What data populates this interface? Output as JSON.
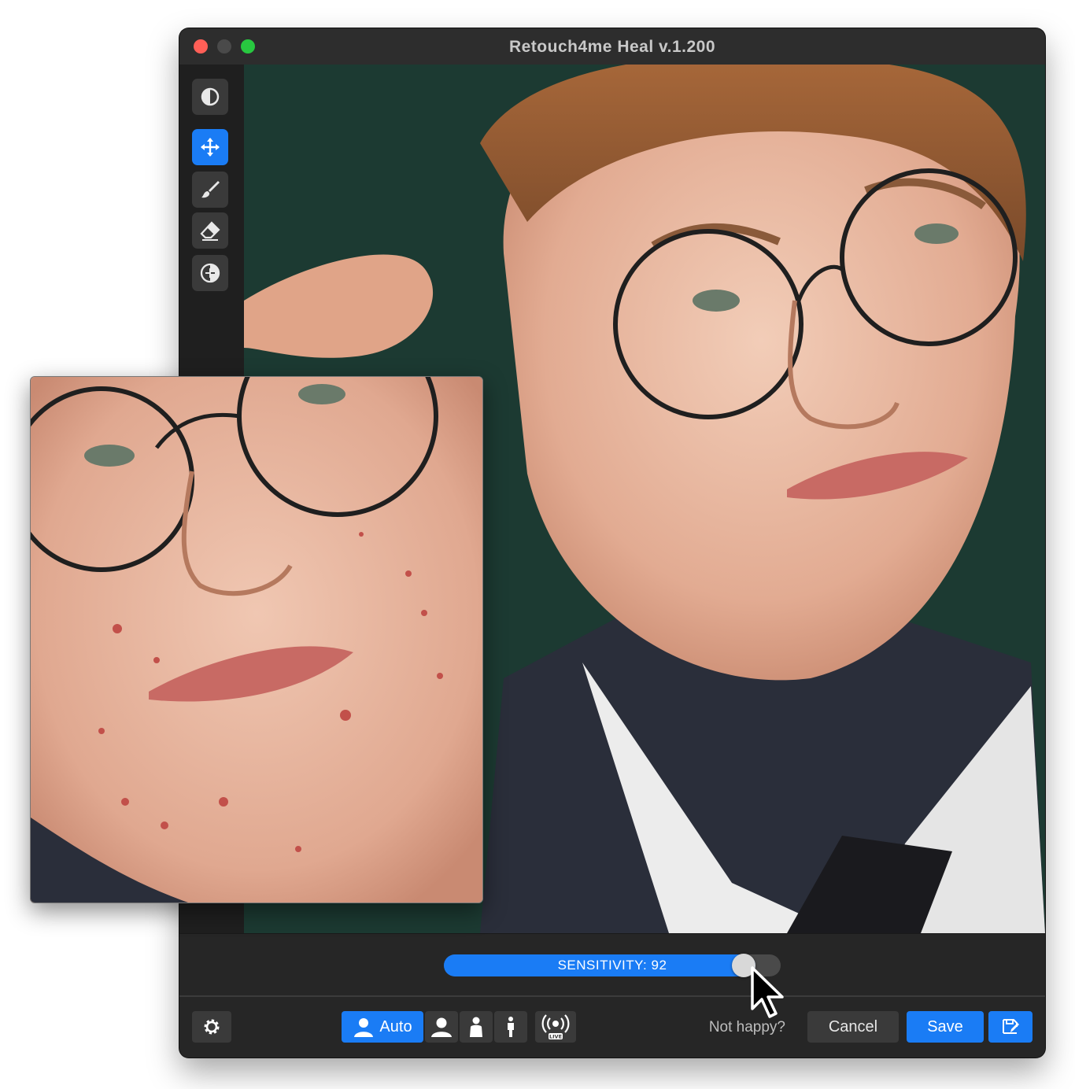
{
  "window": {
    "title": "Retouch4me Heal v.1.200"
  },
  "toolbar": {
    "tools": [
      {
        "name": "before-after-tool",
        "icon": "half-circle-icon",
        "active": false
      },
      {
        "name": "move-tool",
        "icon": "move-arrows-icon",
        "active": true
      },
      {
        "name": "brush-tool",
        "icon": "brush-icon",
        "active": false
      },
      {
        "name": "eraser-tool",
        "icon": "eraser-icon",
        "active": false
      },
      {
        "name": "compare-tool",
        "icon": "compare-circle-icon",
        "active": false
      }
    ]
  },
  "slider": {
    "label": "SENSITIVITY: 92",
    "value": 92,
    "min": 0,
    "max": 100
  },
  "bottom": {
    "modes": [
      {
        "name": "auto",
        "label": "Auto",
        "icon": "person-icon",
        "active": true
      },
      {
        "name": "portrait",
        "label": "",
        "icon": "head-shoulders-icon",
        "active": false
      },
      {
        "name": "half-body",
        "label": "",
        "icon": "half-body-icon",
        "active": false
      },
      {
        "name": "full-body",
        "label": "",
        "icon": "full-body-icon",
        "active": false
      },
      {
        "name": "live",
        "label": "",
        "icon": "live-broadcast-icon",
        "badge": "LIVE",
        "active": false
      }
    ],
    "not_happy": "Not happy?",
    "cancel": "Cancel",
    "save": "Save",
    "save_as_icon": "save-as-icon",
    "settings_icon": "gear-icon"
  },
  "colors": {
    "accent": "#1a7cf5",
    "window_bg": "#2a2a2a",
    "button_bg": "#3a3a3a"
  }
}
